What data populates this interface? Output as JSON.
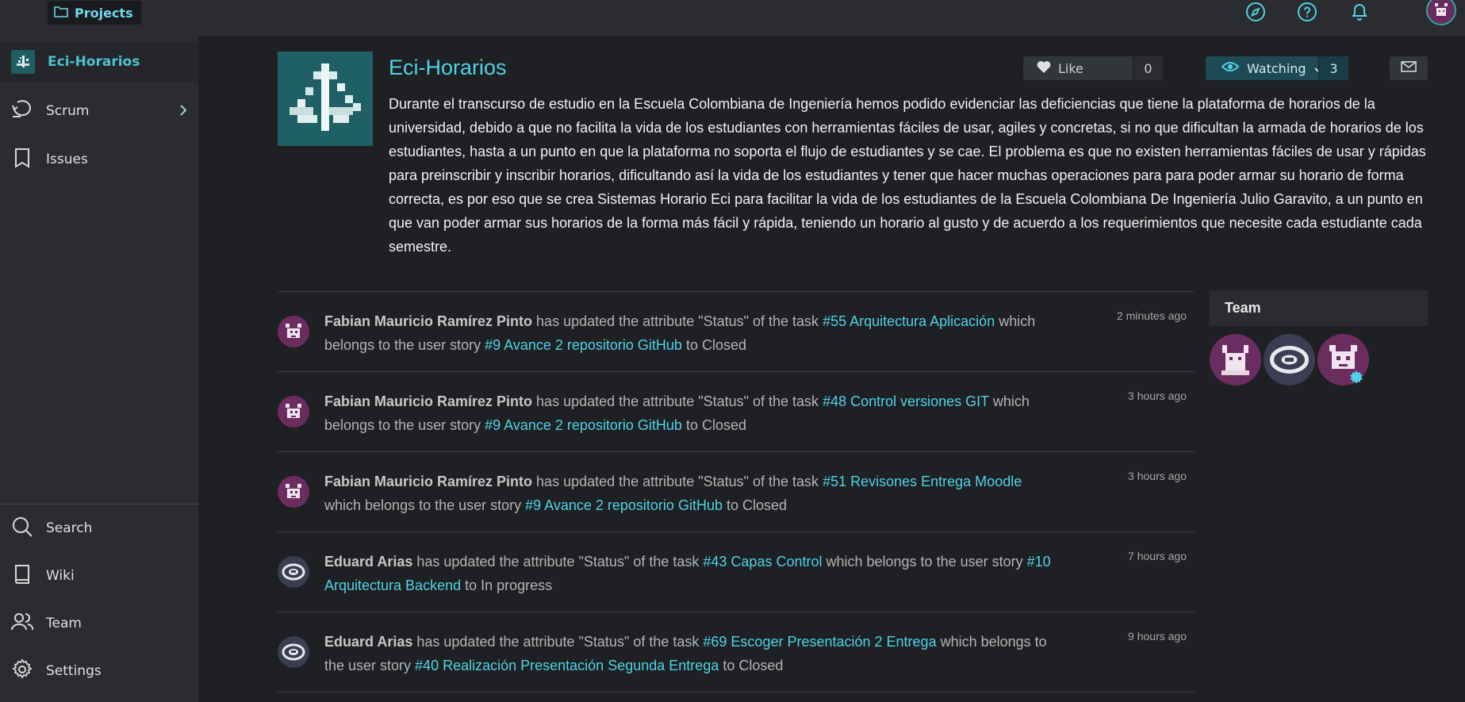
{
  "topbar": {
    "projects_label": "Projects",
    "icons": [
      "compass-icon",
      "help-icon",
      "bell-icon",
      "user-avatar"
    ]
  },
  "sidebar": {
    "project_name": "Eci-Horarios",
    "items": [
      {
        "label": "Scrum",
        "icon": "scrum-icon"
      },
      {
        "label": "Issues",
        "icon": "bookmark-icon"
      }
    ],
    "bottom_items": [
      {
        "label": "Search",
        "icon": "search-icon"
      },
      {
        "label": "Wiki",
        "icon": "book-icon"
      },
      {
        "label": "Team",
        "icon": "team-icon"
      },
      {
        "label": "Settings",
        "icon": "gear-icon"
      }
    ]
  },
  "project": {
    "title": "Eci-Horarios",
    "description": "Durante el transcurso de estudio en la Escuela Colombiana de Ingeniería hemos podido evidenciar las deficiencias que tiene la plataforma de horarios de la universidad, debido a que no facilita la vida de los estudiantes con herramientas fáciles de usar, agiles y concretas, si no que dificultan la armada de horarios de los estudiantes, hasta a un punto en que la plataforma no soporta el flujo de estudiantes y se cae. El problema es que no existen herramientas fáciles de usar y rápidas para preinscribir y inscribir horarios, dificultando así la vida de los estudiantes y tener que hacer muchas operaciones para para poder armar su horario de forma correcta, es por eso que se crea Sistemas Horario Eci para facilitar la vida de los estudiantes de la Escuela Colombiana De Ingeniería Julio Garavito, a un punto en que van poder armar sus horarios de la forma más fácil y rápida, teniendo un horario al gusto y de acuerdo a los requerimientos que necesite cada estudiante cada semestre.",
    "like_label": "Like",
    "like_count": "0",
    "watch_label": "Watching",
    "watch_count": "3"
  },
  "timeline": [
    {
      "user": "Fabian Mauricio Ramírez Pinto",
      "pre": " has updated the attribute \"Status\" of the task ",
      "task": "#55 Arquitectura Aplicación",
      "mid": " which belongs to the user story ",
      "story": "#9 Avance 2 repositorio GitHub",
      "post": " to Closed",
      "time": "2 minutes ago",
      "avatar": "purple"
    },
    {
      "user": "Fabian Mauricio Ramírez Pinto",
      "pre": " has updated the attribute \"Status\" of the task ",
      "task": "#48 Control versiones GIT",
      "mid": " which belongs to the user story ",
      "story": "#9 Avance 2 repositorio GitHub",
      "post": " to Closed",
      "time": "3 hours ago",
      "avatar": "purple"
    },
    {
      "user": "Fabian Mauricio Ramírez Pinto",
      "pre": " has updated the attribute \"Status\" of the task ",
      "task": "#51 Revisones Entrega Moodle",
      "mid": " which belongs to the user story ",
      "story": "#9 Avance 2 repositorio GitHub",
      "post": " to Closed",
      "time": "3 hours ago",
      "avatar": "purple"
    },
    {
      "user": "Eduard Arias",
      "pre": " has updated the attribute \"Status\" of the task ",
      "task": "#43 Capas Control",
      "mid": " which belongs to the user story ",
      "story": "#10 Arquitectura Backend",
      "post": " to In progress",
      "time": "7 hours ago",
      "avatar": "gray"
    },
    {
      "user": "Eduard Arias",
      "pre": " has updated the attribute \"Status\" of the task ",
      "task": "#69 Escoger Presentación 2 Entrega",
      "mid": " which belongs to the user story ",
      "story": "#40 Realización Presentación Segunda Entrega",
      "post": " to Closed",
      "time": "9 hours ago",
      "avatar": "gray"
    }
  ],
  "team": {
    "title": "Team"
  },
  "colors": {
    "accent": "#4fd2e6",
    "background": "#1e2023",
    "sidebar": "#2a2c30"
  }
}
